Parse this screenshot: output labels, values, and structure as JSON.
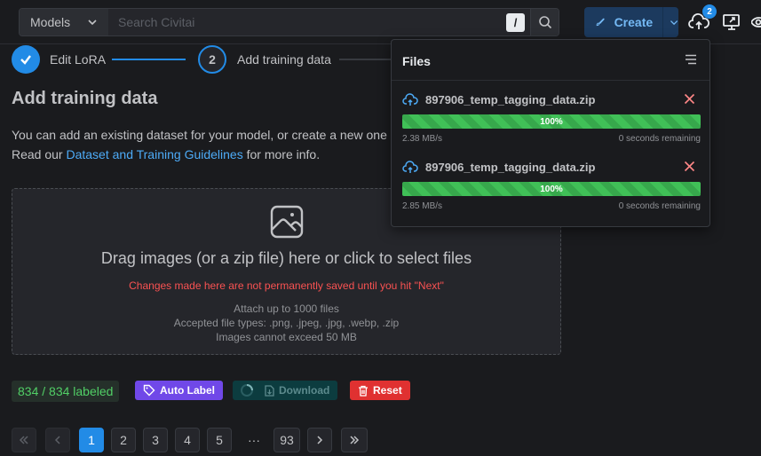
{
  "header": {
    "models_label": "Models",
    "search_placeholder": "Search Civitai",
    "slash_key": "/",
    "create_label": "Create",
    "upload_badge": "2"
  },
  "stepper": {
    "step1_label": "Edit LoRA",
    "step2_number": "2",
    "step2_label": "Add training data"
  },
  "main": {
    "title": "Add training data",
    "desc_line1": "You can add an existing dataset for your model, or create a new one",
    "desc_line2_prefix": "Read our ",
    "desc_link": "Dataset and Training Guidelines",
    "desc_line2_suffix": " for more info."
  },
  "dropzone": {
    "title": "Drag images (or a zip file) here or click to select files",
    "warning": "Changes made here are not permanently saved until you hit \"Next\"",
    "info1": "Attach up to 1000 files",
    "info2": "Accepted file types: .png, .jpeg, .jpg, .webp, .zip",
    "info3": "Images cannot exceed 50 MB"
  },
  "actions": {
    "labeled": "834 / 834 labeled",
    "auto_label": "Auto Label",
    "download": "Download",
    "reset": "Reset"
  },
  "pagination": {
    "pages": [
      "1",
      "2",
      "3",
      "4",
      "5"
    ],
    "dots": "···",
    "last": "93",
    "current": 1
  },
  "files_panel": {
    "title": "Files",
    "items": [
      {
        "name": "897906_temp_tagging_data.zip",
        "progress_label": "100%",
        "progress": 1.0,
        "speed": "2.38 MB/s",
        "remaining": "0 seconds remaining"
      },
      {
        "name": "897906_temp_tagging_data.zip",
        "progress_label": "100%",
        "progress": 1.0,
        "speed": "2.85 MB/s",
        "remaining": "0 seconds remaining"
      }
    ]
  },
  "colors": {
    "accent": "#228be6",
    "success": "#40c057",
    "danger": "#e03131",
    "violet": "#7048e8"
  }
}
